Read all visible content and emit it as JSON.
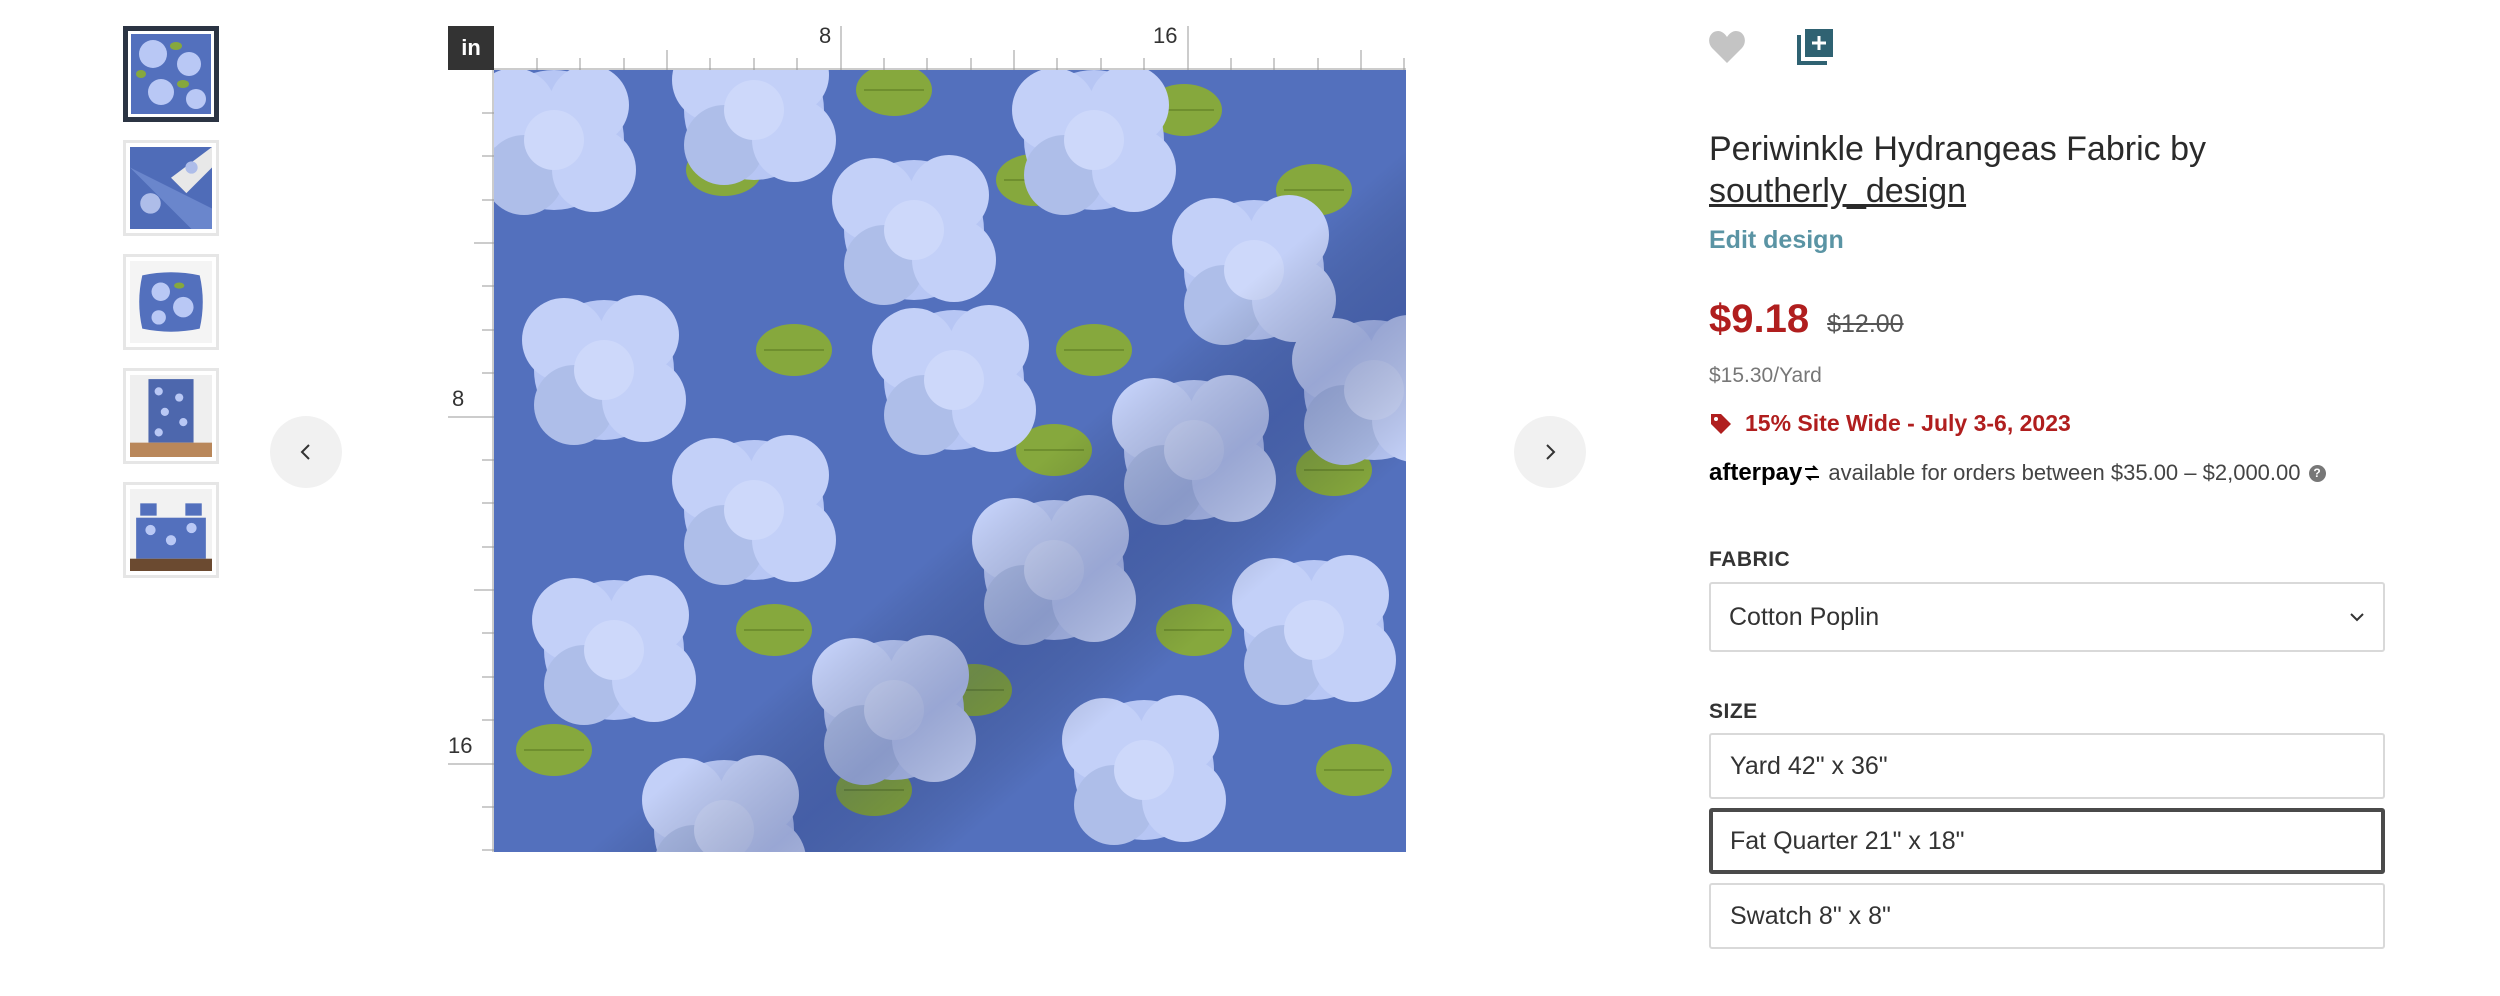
{
  "thumbnails": [
    {
      "kind": "fabric"
    },
    {
      "kind": "drape"
    },
    {
      "kind": "pillow"
    },
    {
      "kind": "curtain"
    },
    {
      "kind": "bedding"
    }
  ],
  "ruler": {
    "unit": "in",
    "top_labels": [
      "8",
      "16"
    ],
    "left_labels": [
      "8",
      "16"
    ]
  },
  "actions": {
    "favorite_icon": "heart-icon",
    "add_collection_icon": "add-to-collection-icon"
  },
  "product": {
    "title": "Periwinkle Hydrangeas Fabric by",
    "designer": "southerly_design",
    "edit_label": "Edit design",
    "sale_price": "$9.18",
    "original_price": "$12.00",
    "per_yard": "$15.30/Yard",
    "promo": "15% Site Wide - July 3-6, 2023",
    "afterpay_logo": "afterpay",
    "afterpay_text": "available for orders between $35.00 – $2,000.00"
  },
  "fabric": {
    "label": "FABRIC",
    "selected": "Cotton Poplin"
  },
  "size": {
    "label": "SIZE",
    "options": [
      "Yard 42\" x 36\"",
      "Fat Quarter 21\" x 18\"",
      "Swatch 8\" x 8\""
    ],
    "selected_index": 1
  },
  "colors": {
    "background_blue": "#5370bd",
    "petal": "#b9c8f5",
    "leaf": "#86a83d",
    "sale_red": "#b01e1e",
    "link_teal": "#5a94a4"
  }
}
